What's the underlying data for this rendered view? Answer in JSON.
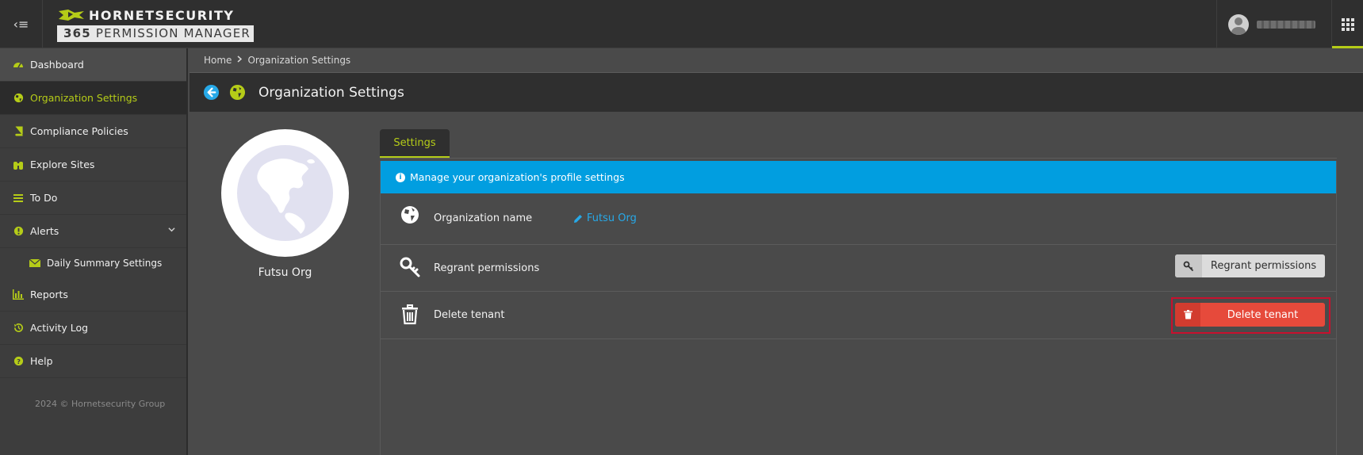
{
  "header": {
    "brand_top": "HORNETSECURITY",
    "brand_bottom_bold": "365",
    "brand_bottom_rest": " PERMISSION MANAGER",
    "menu_toggle_glyph": "‹≡"
  },
  "sidebar": {
    "items": [
      {
        "label": "Dashboard",
        "icon": "dashboard-gauge-icon"
      },
      {
        "label": "Organization Settings",
        "icon": "globe-icon"
      },
      {
        "label": "Compliance Policies",
        "icon": "book-icon"
      },
      {
        "label": "Explore Sites",
        "icon": "binoculars-icon"
      },
      {
        "label": "To Do",
        "icon": "tasks-icon"
      },
      {
        "label": "Alerts",
        "icon": "exclamation-icon"
      },
      {
        "label": "Daily Summary Settings",
        "icon": "envelope-icon"
      },
      {
        "label": "Reports",
        "icon": "bar-chart-icon"
      },
      {
        "label": "Activity Log",
        "icon": "history-icon"
      },
      {
        "label": "Help",
        "icon": "question-icon"
      }
    ],
    "copyright": "2024  © Hornetsecurity Group"
  },
  "breadcrumb": {
    "home": "Home",
    "current": "Organization Settings"
  },
  "page": {
    "title": "Organization Settings"
  },
  "profile": {
    "name": "Futsu Org"
  },
  "tabs": [
    {
      "label": "Settings",
      "active": true
    }
  ],
  "settings": {
    "banner": "Manage your organization's profile settings",
    "org_name_label": "Organization name",
    "org_name_value": "Futsu Org",
    "regrant_label": "Regrant permissions",
    "regrant_button": "Regrant permissions",
    "delete_label": "Delete tenant",
    "delete_button": "Delete tenant"
  },
  "colors": {
    "accent": "#b5cc18",
    "info": "#019ee0",
    "danger": "#e64a3b",
    "link": "#27a9e8"
  }
}
